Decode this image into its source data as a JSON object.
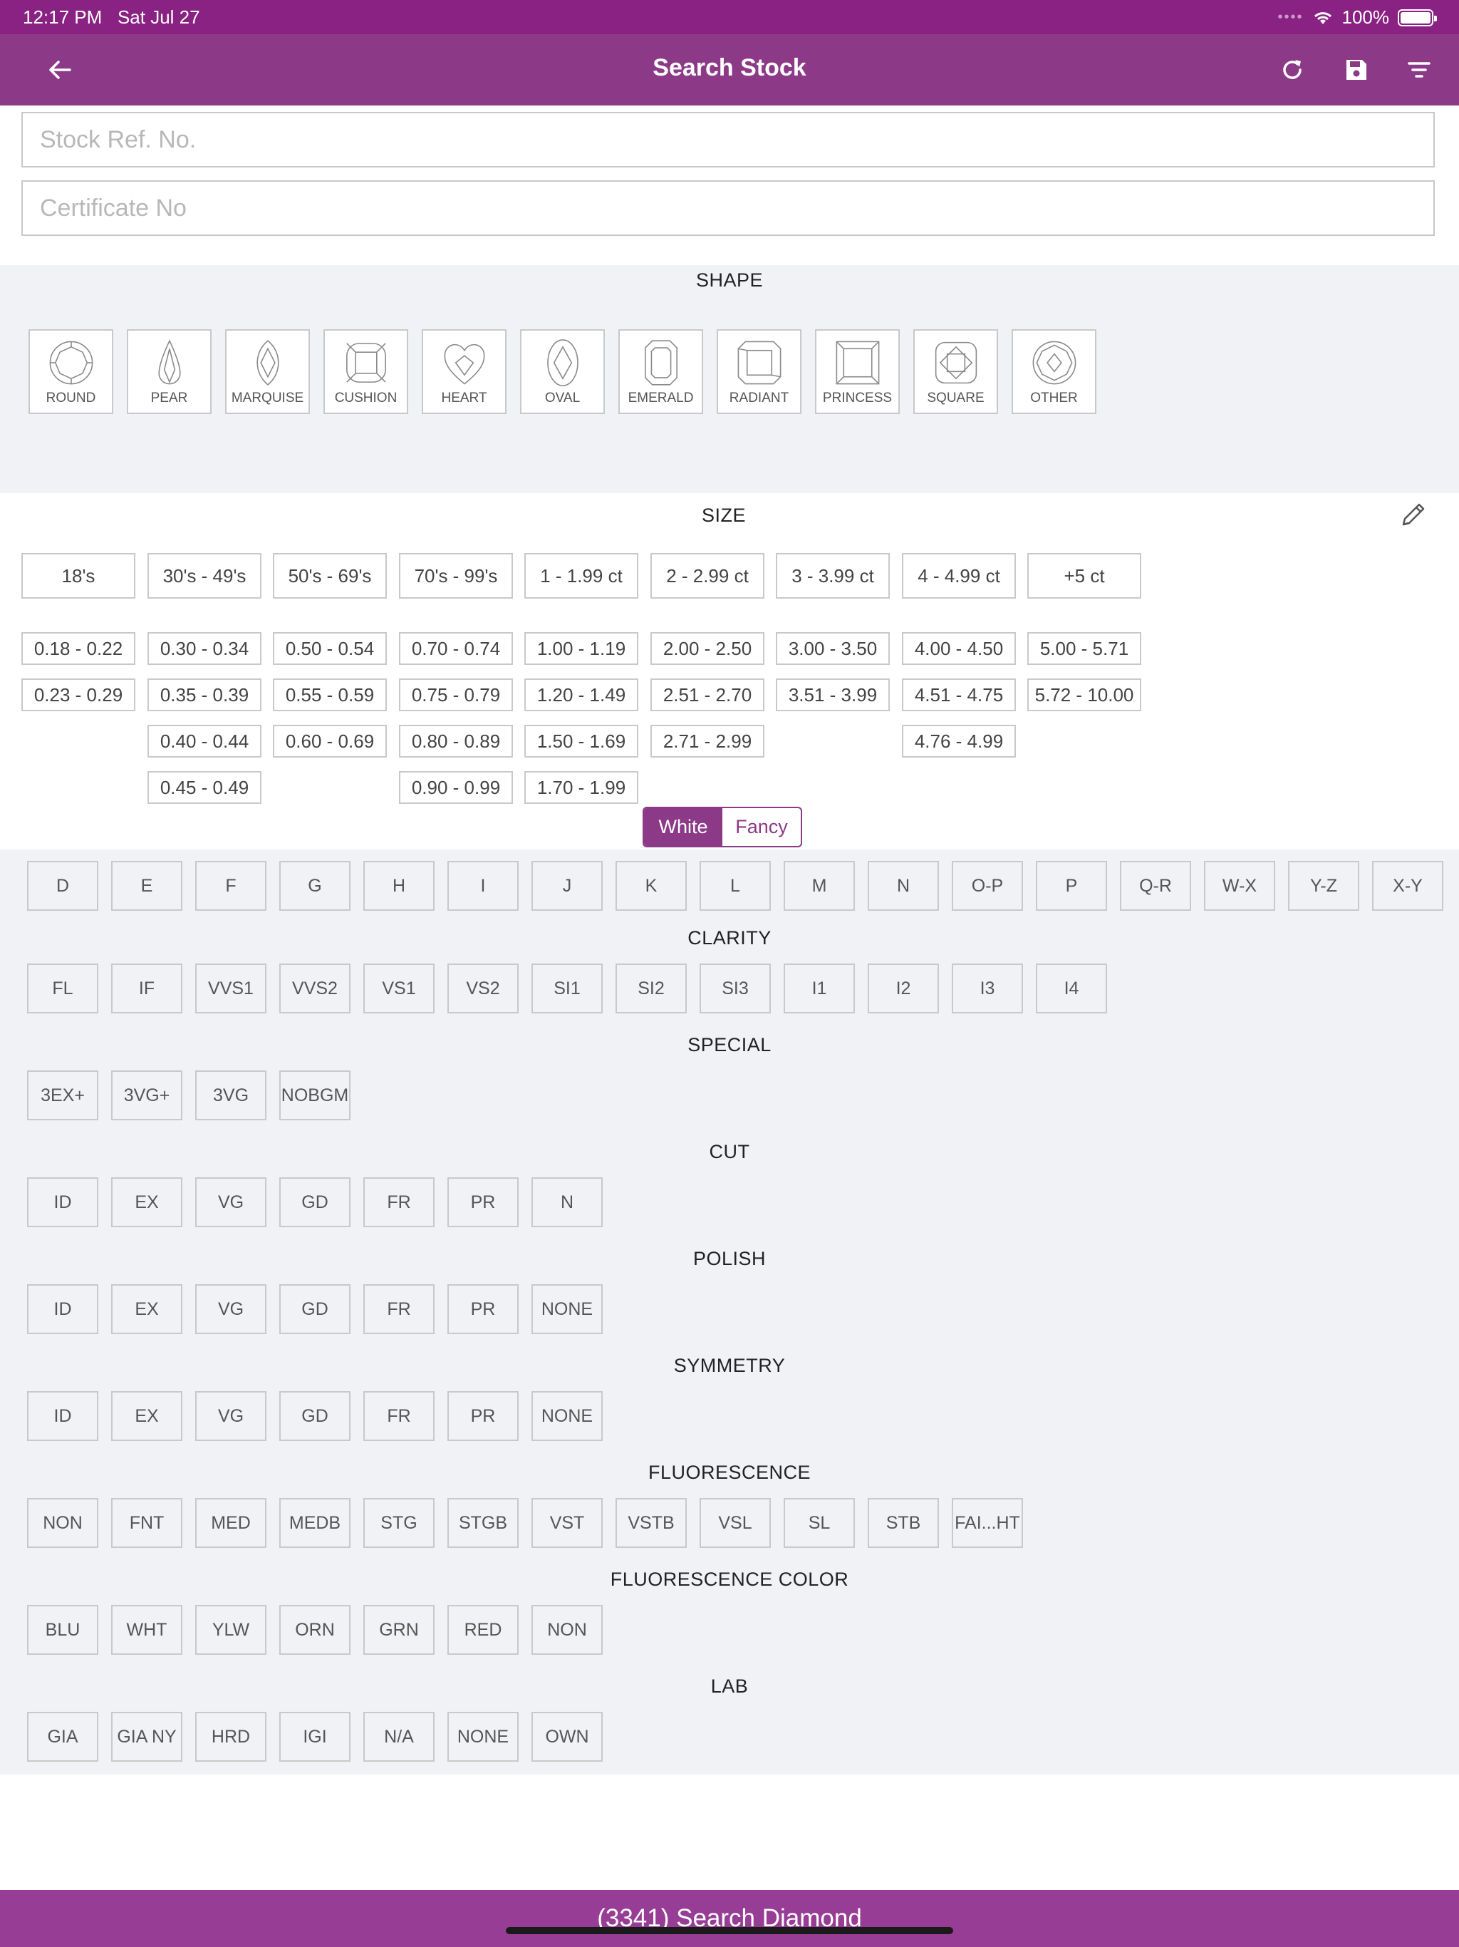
{
  "status": {
    "time": "12:17 PM",
    "date": "Sat Jul 27",
    "battery": "100%",
    "battery_level": 1.0
  },
  "nav": {
    "title": "Search Stock"
  },
  "inputs": {
    "stock_ref_placeholder": "Stock Ref. No.",
    "certificate_placeholder": "Certificate No"
  },
  "shape": {
    "title": "SHAPE",
    "items": [
      "ROUND",
      "PEAR",
      "MARQUISE",
      "CUSHION",
      "HEART",
      "OVAL",
      "EMERALD",
      "RADIANT",
      "PRINCESS",
      "SQUARE",
      "OTHER"
    ]
  },
  "size": {
    "title": "SIZE",
    "columns": [
      {
        "head": "18's",
        "items": [
          "0.18 - 0.22",
          "0.23 - 0.29"
        ]
      },
      {
        "head": "30's - 49's",
        "items": [
          "0.30 - 0.34",
          "0.35 - 0.39",
          "0.40 - 0.44",
          "0.45 - 0.49"
        ]
      },
      {
        "head": "50's - 69's",
        "items": [
          "0.50 - 0.54",
          "0.55 - 0.59",
          "0.60 - 0.69"
        ]
      },
      {
        "head": "70's - 99's",
        "items": [
          "0.70 - 0.74",
          "0.75 - 0.79",
          "0.80 - 0.89",
          "0.90 - 0.99"
        ]
      },
      {
        "head": "1 - 1.99 ct",
        "items": [
          "1.00 - 1.19",
          "1.20 - 1.49",
          "1.50 - 1.69",
          "1.70 - 1.99"
        ]
      },
      {
        "head": "2 - 2.99 ct",
        "items": [
          "2.00 - 2.50",
          "2.51 - 2.70",
          "2.71 - 2.99"
        ]
      },
      {
        "head": "3 - 3.99 ct",
        "items": [
          "3.00 - 3.50",
          "3.51 - 3.99"
        ]
      },
      {
        "head": "4 - 4.99 ct",
        "items": [
          "4.00 - 4.50",
          "4.51 - 4.75",
          "4.76 - 4.99"
        ]
      },
      {
        "head": "+5 ct",
        "items": [
          "5.00 - 5.71",
          "5.72 - 10.00"
        ]
      }
    ]
  },
  "color_toggle": {
    "white": "White",
    "fancy": "Fancy",
    "selected": "White"
  },
  "colors": [
    "D",
    "E",
    "F",
    "G",
    "H",
    "I",
    "J",
    "K",
    "L",
    "M",
    "N",
    "O-P",
    "P",
    "Q-R",
    "W-X",
    "Y-Z",
    "X-Y"
  ],
  "sections": [
    {
      "key": "clarity",
      "title": "CLARITY",
      "items": [
        "FL",
        "IF",
        "VVS1",
        "VVS2",
        "VS1",
        "VS2",
        "SI1",
        "SI2",
        "SI3",
        "I1",
        "I2",
        "I3",
        "I4"
      ]
    },
    {
      "key": "special",
      "title": "SPECIAL",
      "items": [
        "3EX+",
        "3VG+",
        "3VG",
        "NOBGM"
      ]
    },
    {
      "key": "cut",
      "title": "CUT",
      "items": [
        "ID",
        "EX",
        "VG",
        "GD",
        "FR",
        "PR",
        "N"
      ]
    },
    {
      "key": "polish",
      "title": "POLISH",
      "items": [
        "ID",
        "EX",
        "VG",
        "GD",
        "FR",
        "PR",
        "NONE"
      ]
    },
    {
      "key": "symmetry",
      "title": "SYMMETRY",
      "items": [
        "ID",
        "EX",
        "VG",
        "GD",
        "FR",
        "PR",
        "NONE"
      ]
    },
    {
      "key": "fluorescence",
      "title": "FLUORESCENCE",
      "items": [
        "NON",
        "FNT",
        "MED",
        "MEDB",
        "STG",
        "STGB",
        "VST",
        "VSTB",
        "VSL",
        "SL",
        "STB",
        "FAI...HT"
      ]
    },
    {
      "key": "fluorescence-color",
      "title": "FLUORESCENCE COLOR",
      "items": [
        "BLU",
        "WHT",
        "YLW",
        "ORN",
        "GRN",
        "RED",
        "NON"
      ]
    },
    {
      "key": "lab",
      "title": "LAB",
      "items": [
        "GIA",
        "GIA NY",
        "HRD",
        "IGI",
        "N/A",
        "NONE",
        "OWN"
      ]
    }
  ],
  "bottom": {
    "label": "(3341) Search Diamond"
  },
  "theme": {
    "primary": "#8c3a88",
    "status_bar": "#8a2283",
    "panel": "#f1f2f6"
  }
}
